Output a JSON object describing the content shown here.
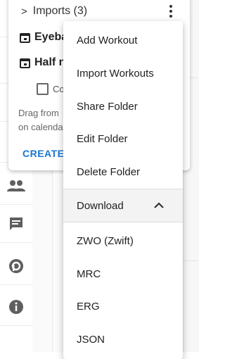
{
  "sidebar": {
    "icons": [
      "document-icon",
      "chevrons-up-icon",
      "search-icon",
      "settings-icon",
      "people-icon",
      "chat-icon",
      "discourse-icon",
      "info-icon"
    ]
  },
  "folder": {
    "title": "Imports (3)",
    "workouts": [
      "Eyeba",
      "Half n"
    ],
    "checkbox_label": "Co",
    "hint_lines": [
      "Drag from",
      "on calenda"
    ],
    "create_label": "CREATE"
  },
  "menu": {
    "items": [
      "Add Workout",
      "Import Workouts",
      "Share Folder",
      "Edit Folder",
      "Delete Folder"
    ],
    "download_label": "Download",
    "download_expanded": true,
    "download_options": [
      "ZWO (Zwift)",
      "MRC",
      "ERG",
      "JSON"
    ]
  },
  "colors": {
    "accent": "#1976d2",
    "icon": "#5f5f5f",
    "menu_active_bg": "#f3f3f3"
  }
}
